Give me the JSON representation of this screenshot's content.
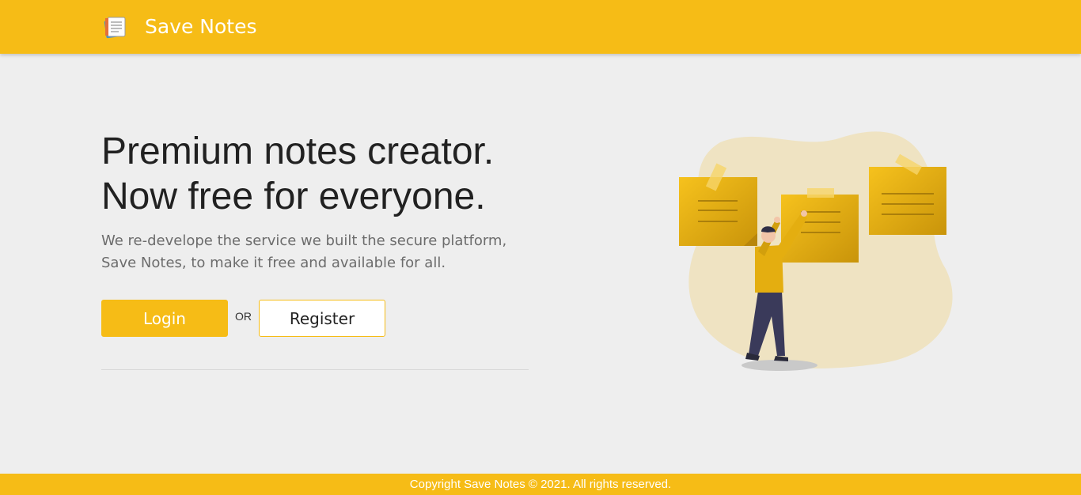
{
  "brand": {
    "name": "Save Notes",
    "logo_icon": "notebook-icon"
  },
  "hero": {
    "title_line1": "Premium notes creator.",
    "title_line2": "Now free for everyone.",
    "text_line1": "We re-develope the service we built the secure platform,",
    "text_line2": "Save Notes, to make it free and available for all."
  },
  "actions": {
    "login_label": "Login",
    "or_label": "OR",
    "register_label": "Register"
  },
  "illustration": {
    "icon": "person-with-sticky-notes-illustration"
  },
  "footer": {
    "copyright": "Copyright Save Notes © 2021. All rights reserved."
  },
  "colors": {
    "brand": "#f6bc16",
    "background": "#eeeeee",
    "heading": "#212121",
    "body_text": "#6c6c6c"
  }
}
